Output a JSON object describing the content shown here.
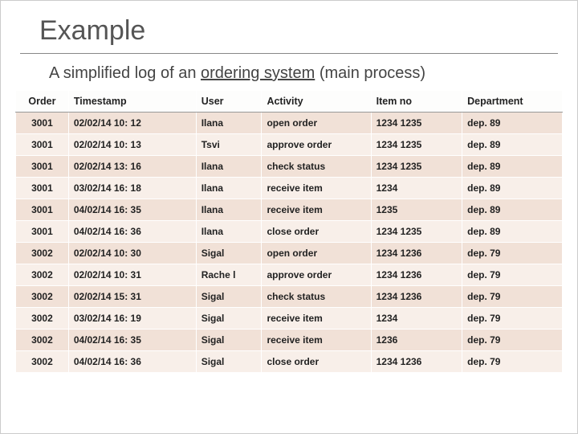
{
  "title": "Example",
  "subtitle_a": "A simplified log of an ",
  "subtitle_b": "ordering system",
  "subtitle_c": " (main process)",
  "headers": {
    "order": "Order",
    "timestamp": "Timestamp",
    "user": "User",
    "activity": "Activity",
    "item": "Item no",
    "dept": "Department"
  },
  "rows": [
    {
      "order": "3001",
      "ts": "02/02/14 10: 12",
      "user": "Ilana",
      "act": "open order",
      "item": "1234  1235",
      "dep": "dep.  89"
    },
    {
      "order": "3001",
      "ts": "02/02/14 10: 13",
      "user": "Tsvi",
      "act": "approve order",
      "item": "1234  1235",
      "dep": "dep.  89"
    },
    {
      "order": "3001",
      "ts": "02/02/14 13: 16",
      "user": "Ilana",
      "act": "check status",
      "item": "1234  1235",
      "dep": "dep.  89"
    },
    {
      "order": "3001",
      "ts": "03/02/14 16: 18",
      "user": "Ilana",
      "act": "receive item",
      "item": "1234",
      "dep": "dep.  89"
    },
    {
      "order": "3001",
      "ts": "04/02/14 16: 35",
      "user": "Ilana",
      "act": "receive item",
      "item": "1235",
      "dep": "dep.  89"
    },
    {
      "order": "3001",
      "ts": "04/02/14 16: 36",
      "user": "Ilana",
      "act": "close order",
      "item": "1234  1235",
      "dep": "dep.  89"
    },
    {
      "order": "3002",
      "ts": "02/02/14 10: 30",
      "user": "Sigal",
      "act": "open order",
      "item": "1234  1236",
      "dep": "dep.  79"
    },
    {
      "order": "3002",
      "ts": "02/02/14 10: 31",
      "user": "Rache l",
      "act": "approve order",
      "item": "1234  1236",
      "dep": "dep.  79"
    },
    {
      "order": "3002",
      "ts": "02/02/14 15: 31",
      "user": "Sigal",
      "act": "check status",
      "item": "1234  1236",
      "dep": "dep.  79"
    },
    {
      "order": "3002",
      "ts": "03/02/14 16: 19",
      "user": "Sigal",
      "act": "receive item",
      "item": "1234",
      "dep": "dep.  79"
    },
    {
      "order": "3002",
      "ts": "04/02/14 16: 35",
      "user": "Sigal",
      "act": "receive item",
      "item": "1236",
      "dep": "dep.  79"
    },
    {
      "order": "3002",
      "ts": "04/02/14 16: 36",
      "user": "Sigal",
      "act": "close order",
      "item": "1234  1236",
      "dep": "dep.  79"
    }
  ]
}
